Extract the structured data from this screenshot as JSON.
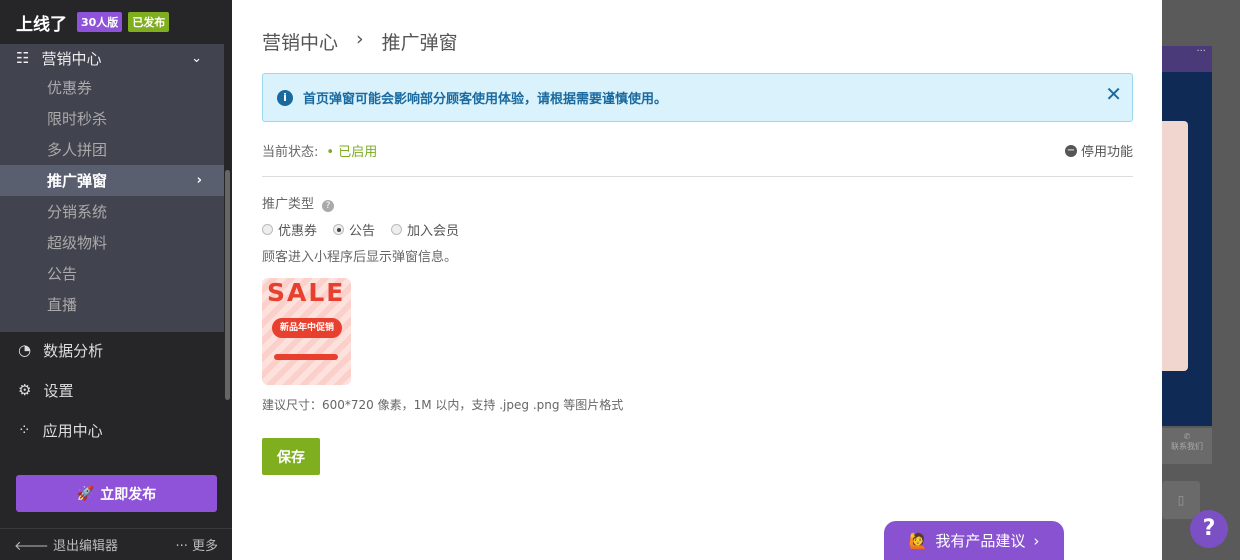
{
  "brand": {
    "logo": "上线了",
    "plan_badge": "30人版",
    "status_badge": "已发布",
    "plan_color": "#8e53d9",
    "status_color": "#7fae1f"
  },
  "sidebar": {
    "group": {
      "label": "营销中心",
      "items": [
        "优惠券",
        "限时秒杀",
        "多人拼团",
        "推广弹窗",
        "分销系统",
        "超级物料",
        "公告",
        "直播"
      ],
      "active": "推广弹窗"
    },
    "items": [
      {
        "label": "数据分析"
      },
      {
        "label": "设置"
      },
      {
        "label": "应用中心"
      }
    ],
    "publish": "立即发布",
    "exit": "退出编辑器",
    "more": "更多"
  },
  "modal": {
    "breadcrumb": [
      "营销中心",
      "推广弹窗"
    ],
    "alert": "首页弹窗可能会影响部分顾客使用体验，请根据需要谨慎使用。",
    "status_label": "当前状态:",
    "status_value": "已启用",
    "disable": "停用功能",
    "type_label": "推广类型",
    "options": [
      "优惠券",
      "公告",
      "加入会员"
    ],
    "selected": "公告",
    "desc": "顾客进入小程序后显示弹窗信息。",
    "image": {
      "title": "SALE",
      "pill": "新品年中促销"
    },
    "hint": "建议尺寸：600*720 像素，1M 以内，支持 .jpeg .png 等图片格式",
    "save": "保存"
  },
  "suggest": "我有产品建议",
  "background": {
    "contact": "联系我们",
    "dots": "···"
  },
  "help": "?"
}
